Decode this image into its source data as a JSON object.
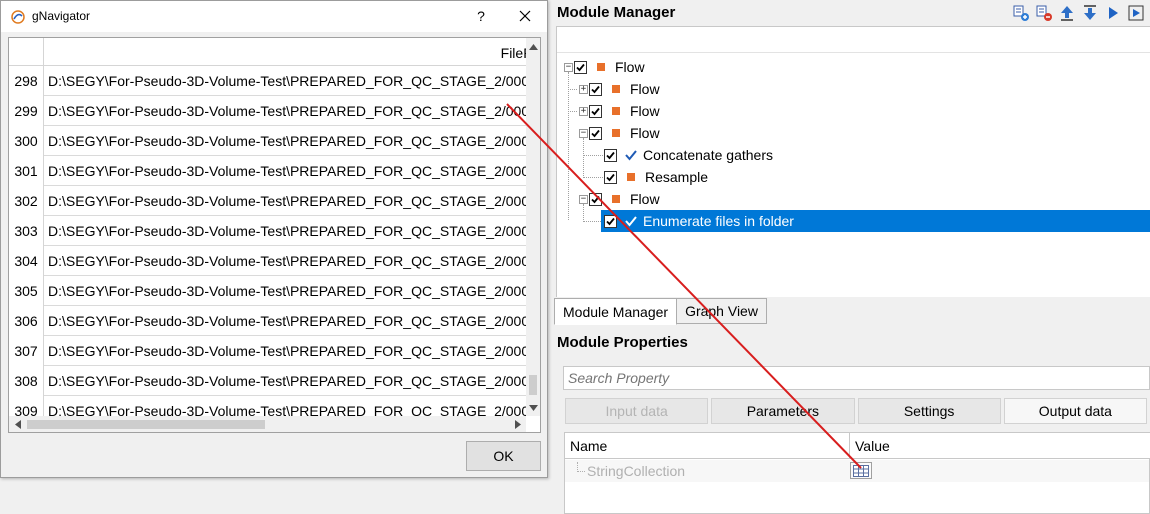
{
  "gnavigator": {
    "title": "gNavigator",
    "help_label": "?",
    "column_header": "FilePath",
    "rows": [
      {
        "num": "298",
        "path": "D:\\SEGY\\For-Pseudo-3D-Volume-Test\\PREPARED_FOR_QC_STAGE_2/000"
      },
      {
        "num": "299",
        "path": "D:\\SEGY\\For-Pseudo-3D-Volume-Test\\PREPARED_FOR_QC_STAGE_2/000"
      },
      {
        "num": "300",
        "path": "D:\\SEGY\\For-Pseudo-3D-Volume-Test\\PREPARED_FOR_QC_STAGE_2/000"
      },
      {
        "num": "301",
        "path": "D:\\SEGY\\For-Pseudo-3D-Volume-Test\\PREPARED_FOR_QC_STAGE_2/000"
      },
      {
        "num": "302",
        "path": "D:\\SEGY\\For-Pseudo-3D-Volume-Test\\PREPARED_FOR_QC_STAGE_2/000"
      },
      {
        "num": "303",
        "path": "D:\\SEGY\\For-Pseudo-3D-Volume-Test\\PREPARED_FOR_QC_STAGE_2/000"
      },
      {
        "num": "304",
        "path": "D:\\SEGY\\For-Pseudo-3D-Volume-Test\\PREPARED_FOR_QC_STAGE_2/000"
      },
      {
        "num": "305",
        "path": "D:\\SEGY\\For-Pseudo-3D-Volume-Test\\PREPARED_FOR_QC_STAGE_2/000"
      },
      {
        "num": "306",
        "path": "D:\\SEGY\\For-Pseudo-3D-Volume-Test\\PREPARED_FOR_QC_STAGE_2/000"
      },
      {
        "num": "307",
        "path": "D:\\SEGY\\For-Pseudo-3D-Volume-Test\\PREPARED_FOR_QC_STAGE_2/000"
      },
      {
        "num": "308",
        "path": "D:\\SEGY\\For-Pseudo-3D-Volume-Test\\PREPARED_FOR_QC_STAGE_2/000"
      },
      {
        "num": "309",
        "path": "D:\\SEGY\\For-Pseudo-3D-Volume-Test\\PREPARED_FOR_QC_STAGE_2/000"
      }
    ],
    "ok_label": "OK"
  },
  "module_manager": {
    "title": "Module Manager",
    "toolbar_icons": [
      "add-module-icon",
      "remove-module-icon",
      "move-up-icon",
      "move-down-icon",
      "run-icon",
      "run-step-icon"
    ],
    "tree": [
      {
        "label": "Flow",
        "marker": "orange",
        "checked": true,
        "expander": "minus"
      },
      {
        "label": "Flow",
        "marker": "orange",
        "checked": true,
        "expander": "plus"
      },
      {
        "label": "Flow",
        "marker": "orange",
        "checked": true,
        "expander": "plus"
      },
      {
        "label": "Flow",
        "marker": "orange",
        "checked": true,
        "expander": "minus"
      },
      {
        "label": "Concatenate gathers",
        "marker": "check",
        "checked": true
      },
      {
        "label": "Resample",
        "marker": "orange",
        "checked": true
      },
      {
        "label": "Flow",
        "marker": "orange",
        "checked": true,
        "expander": "minus"
      },
      {
        "label": "Enumerate files in folder",
        "marker": "check",
        "checked": true,
        "selected": true
      }
    ],
    "tabs": [
      "Module Manager",
      "Graph View"
    ],
    "active_tab": "Module Manager"
  },
  "module_properties": {
    "title": "Module Properties",
    "search_placeholder": "Search Property",
    "tabs": [
      "Input data",
      "Parameters",
      "Settings",
      "Output data"
    ],
    "active_tab": "Output data",
    "disabled_tab": "Input data",
    "grid_headers": {
      "name": "Name",
      "value": "Value"
    },
    "rows": [
      {
        "name": "StringCollection",
        "value_icon": "table-icon"
      }
    ]
  },
  "colors": {
    "selection": "#0078d7",
    "flow_marker": "#e8702a",
    "annotation_arrow": "#d81e1e"
  }
}
